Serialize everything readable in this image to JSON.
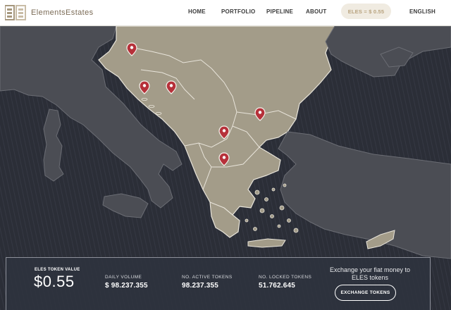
{
  "brand": {
    "name": "ElementsEstates"
  },
  "nav": {
    "home": "HOME",
    "portfolio": "PORTFOLIO",
    "pipeline": "PIPELINE",
    "about": "ABOUT",
    "price": "ELES = $ 0.55",
    "language": "ENGLISH"
  },
  "colors": {
    "land_balkans": "#a39c89",
    "land_other": "#4b4d54",
    "sea": "#2a2d36",
    "marker": "#b6313a",
    "accent": "#b8a37f"
  },
  "map": {
    "markers": [
      {
        "name": "marker-slovenia"
      },
      {
        "name": "marker-croatia"
      },
      {
        "name": "marker-bosnia"
      },
      {
        "name": "marker-serbia"
      },
      {
        "name": "marker-north-macedonia"
      },
      {
        "name": "marker-bulgaria"
      },
      {
        "name": "marker-greece"
      }
    ]
  },
  "stats": {
    "token_value_label": "ELES TOKEN VALUE",
    "token_value": "$0.55",
    "daily_volume_label": "DAILY VOLUME",
    "daily_volume": "$ 98.237.355",
    "active_tokens_label": "NO. ACTIVE TOKENS",
    "active_tokens": "98.237.355",
    "locked_tokens_label": "NO. LOCKED TOKENS",
    "locked_tokens": "51.762.645",
    "exchange_text": "Exchange your fiat money to ELES tokens",
    "exchange_button": "EXCHANGE TOKENS"
  }
}
